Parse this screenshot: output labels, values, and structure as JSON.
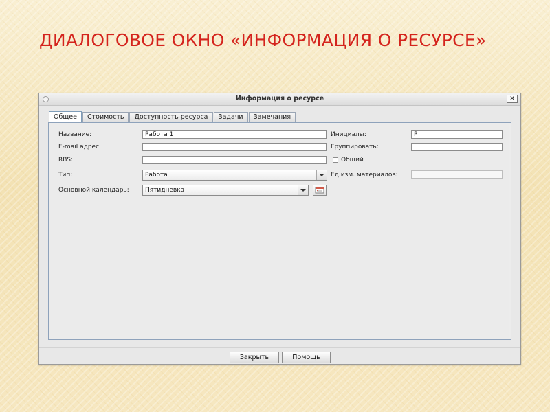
{
  "slide": {
    "title": "ДИАЛОГОВОЕ ОКНО «ИНФОРМАЦИЯ О РЕСУРСЕ»"
  },
  "colors": {
    "slide_title": "#d4241d",
    "dialog_bg": "#e8e8e8",
    "active_tab_border": "#7f9db9"
  },
  "dialog": {
    "title": "Информация о ресурсе",
    "close_glyph": "✕",
    "window_icon": "circle-icon",
    "tabs": [
      {
        "label": "Общее",
        "active": true
      },
      {
        "label": "Стоимость",
        "active": false
      },
      {
        "label": "Доступность ресурса",
        "active": false
      },
      {
        "label": "Задачи",
        "active": false
      },
      {
        "label": "Замечания",
        "active": false
      }
    ],
    "form": {
      "name_label": "Название:",
      "name_value": "Работа 1",
      "email_label": "E-mail адрес:",
      "email_value": "",
      "rbs_label": "RBS:",
      "rbs_value": "",
      "type_label": "Тип:",
      "type_value": "Работа",
      "calendar_label": "Основной календарь:",
      "calendar_value": "Пятидневка",
      "initials_label": "Инициалы:",
      "initials_value": "Р",
      "group_label": "Группировать:",
      "group_value": "",
      "shared_label": "Общий",
      "shared_checked": false,
      "material_unit_label": "Ед.изм. материалов:",
      "material_unit_value": ""
    },
    "buttons": {
      "close": "Закрыть",
      "help": "Помощь"
    }
  }
}
